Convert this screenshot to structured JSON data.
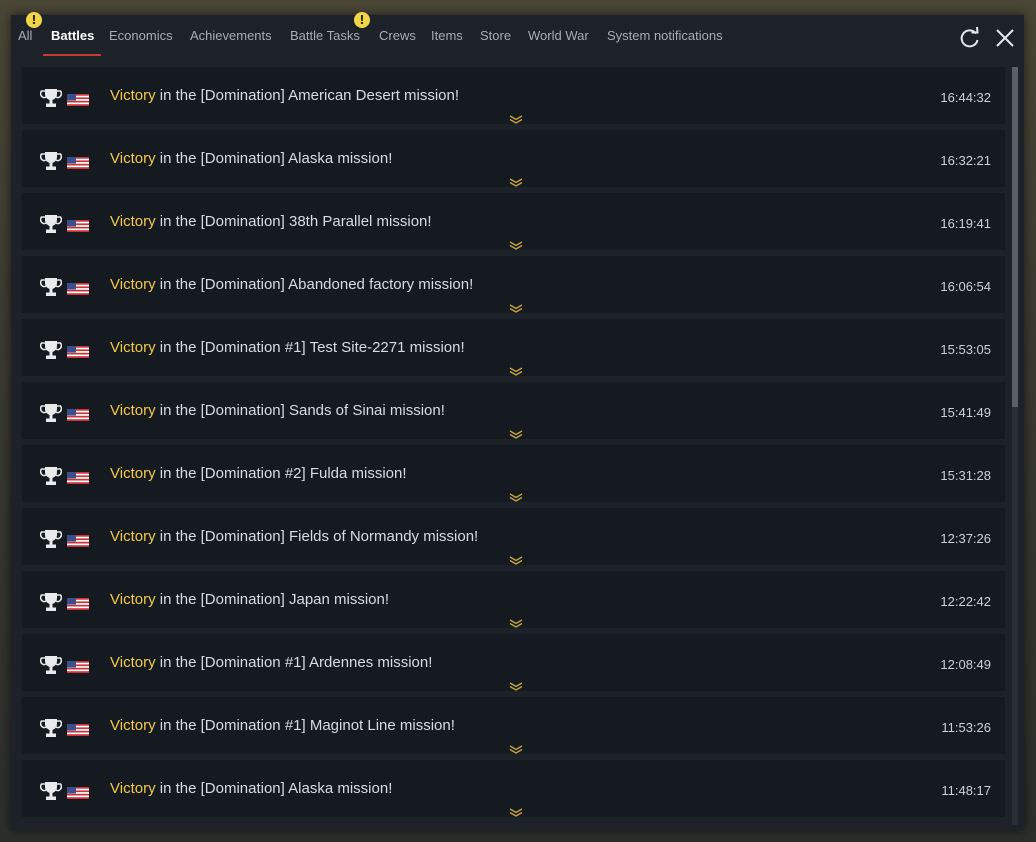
{
  "tabs": [
    {
      "label": "All",
      "warning": "!"
    },
    {
      "label": "Battles",
      "active": true
    },
    {
      "label": "Economics"
    },
    {
      "label": "Achievements"
    },
    {
      "label": "Battle Tasks",
      "warning": "!"
    },
    {
      "label": "Crews"
    },
    {
      "label": "Items"
    },
    {
      "label": "Store"
    },
    {
      "label": "World War"
    },
    {
      "label": "System notifications"
    }
  ],
  "header_icons": [
    "refresh-icon",
    "close-icon"
  ],
  "colors": {
    "accent": "#c03a2e",
    "highlight": "#f2c94c",
    "warning": "#f0d44a"
  },
  "notifications": [
    {
      "result": "Victory",
      "text": " in the [Domination] American Desert mission!",
      "time": "16:44:32"
    },
    {
      "result": "Victory",
      "text": " in the [Domination] Alaska mission!",
      "time": "16:32:21"
    },
    {
      "result": "Victory",
      "text": " in the [Domination] 38th Parallel mission!",
      "time": "16:19:41"
    },
    {
      "result": "Victory",
      "text": " in the [Domination] Abandoned factory mission!",
      "time": "16:06:54"
    },
    {
      "result": "Victory",
      "text": " in the [Domination #1] Test Site-2271 mission!",
      "time": "15:53:05"
    },
    {
      "result": "Victory",
      "text": " in the [Domination] Sands of Sinai mission!",
      "time": "15:41:49"
    },
    {
      "result": "Victory",
      "text": " in the [Domination #2] Fulda mission!",
      "time": "15:31:28"
    },
    {
      "result": "Victory",
      "text": " in the [Domination] Fields of Normandy mission!",
      "time": "12:37:26"
    },
    {
      "result": "Victory",
      "text": " in the [Domination] Japan mission!",
      "time": "12:22:42"
    },
    {
      "result": "Victory",
      "text": " in the [Domination #1] Ardennes mission!",
      "time": "12:08:49"
    },
    {
      "result": "Victory",
      "text": " in the [Domination #1] Maginot Line mission!",
      "time": "11:53:26"
    },
    {
      "result": "Victory",
      "text": " in the [Domination] Alaska mission!",
      "time": "11:48:17"
    }
  ]
}
